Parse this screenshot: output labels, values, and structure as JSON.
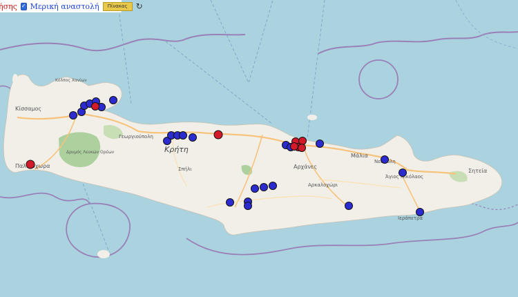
{
  "toolbar": {
    "left_text": "ήσης",
    "checkbox_checked": true,
    "checkbox_label": "Μερική αναστολή",
    "table_button": "Πίνακας",
    "refresh_icon": "refresh-icon"
  },
  "map": {
    "island_label": "Κρήτη",
    "places": [
      {
        "id": "kissamos",
        "name": "Κίσσαμος"
      },
      {
        "id": "kolpos-chanion",
        "name": "Κόλπος Χανίων"
      },
      {
        "id": "dasos",
        "name": "Δρυμός Λευκών Ορέων"
      },
      {
        "id": "georgioupoli",
        "name": "Γεωργιούπολη"
      },
      {
        "id": "palaiochora",
        "name": "Παλαιόχωρα"
      },
      {
        "id": "spili",
        "name": "Σπήλι"
      },
      {
        "id": "archanes",
        "name": "Αρχάνες"
      },
      {
        "id": "arkalochori",
        "name": "Αρκαλοχώρι"
      },
      {
        "id": "malia",
        "name": "Μάλια"
      },
      {
        "id": "neapoli",
        "name": "Νεάπολη"
      },
      {
        "id": "agios-nikolaos",
        "name": "Άγιος Νικόλαος"
      },
      {
        "id": "sitia",
        "name": "Σητεία"
      },
      {
        "id": "ierapetra",
        "name": "Ιεράπετρα"
      }
    ],
    "colors": {
      "sea": "#aad3df",
      "land": "#f2efe9",
      "forest": "#add19e",
      "boundary": "#9a80b7",
      "road_main": "#f7c37c",
      "marker_full": "#2b2bd0",
      "marker_partial": "#d21a2a"
    },
    "markers_blue_count": 38,
    "markers_red_count": 9
  }
}
